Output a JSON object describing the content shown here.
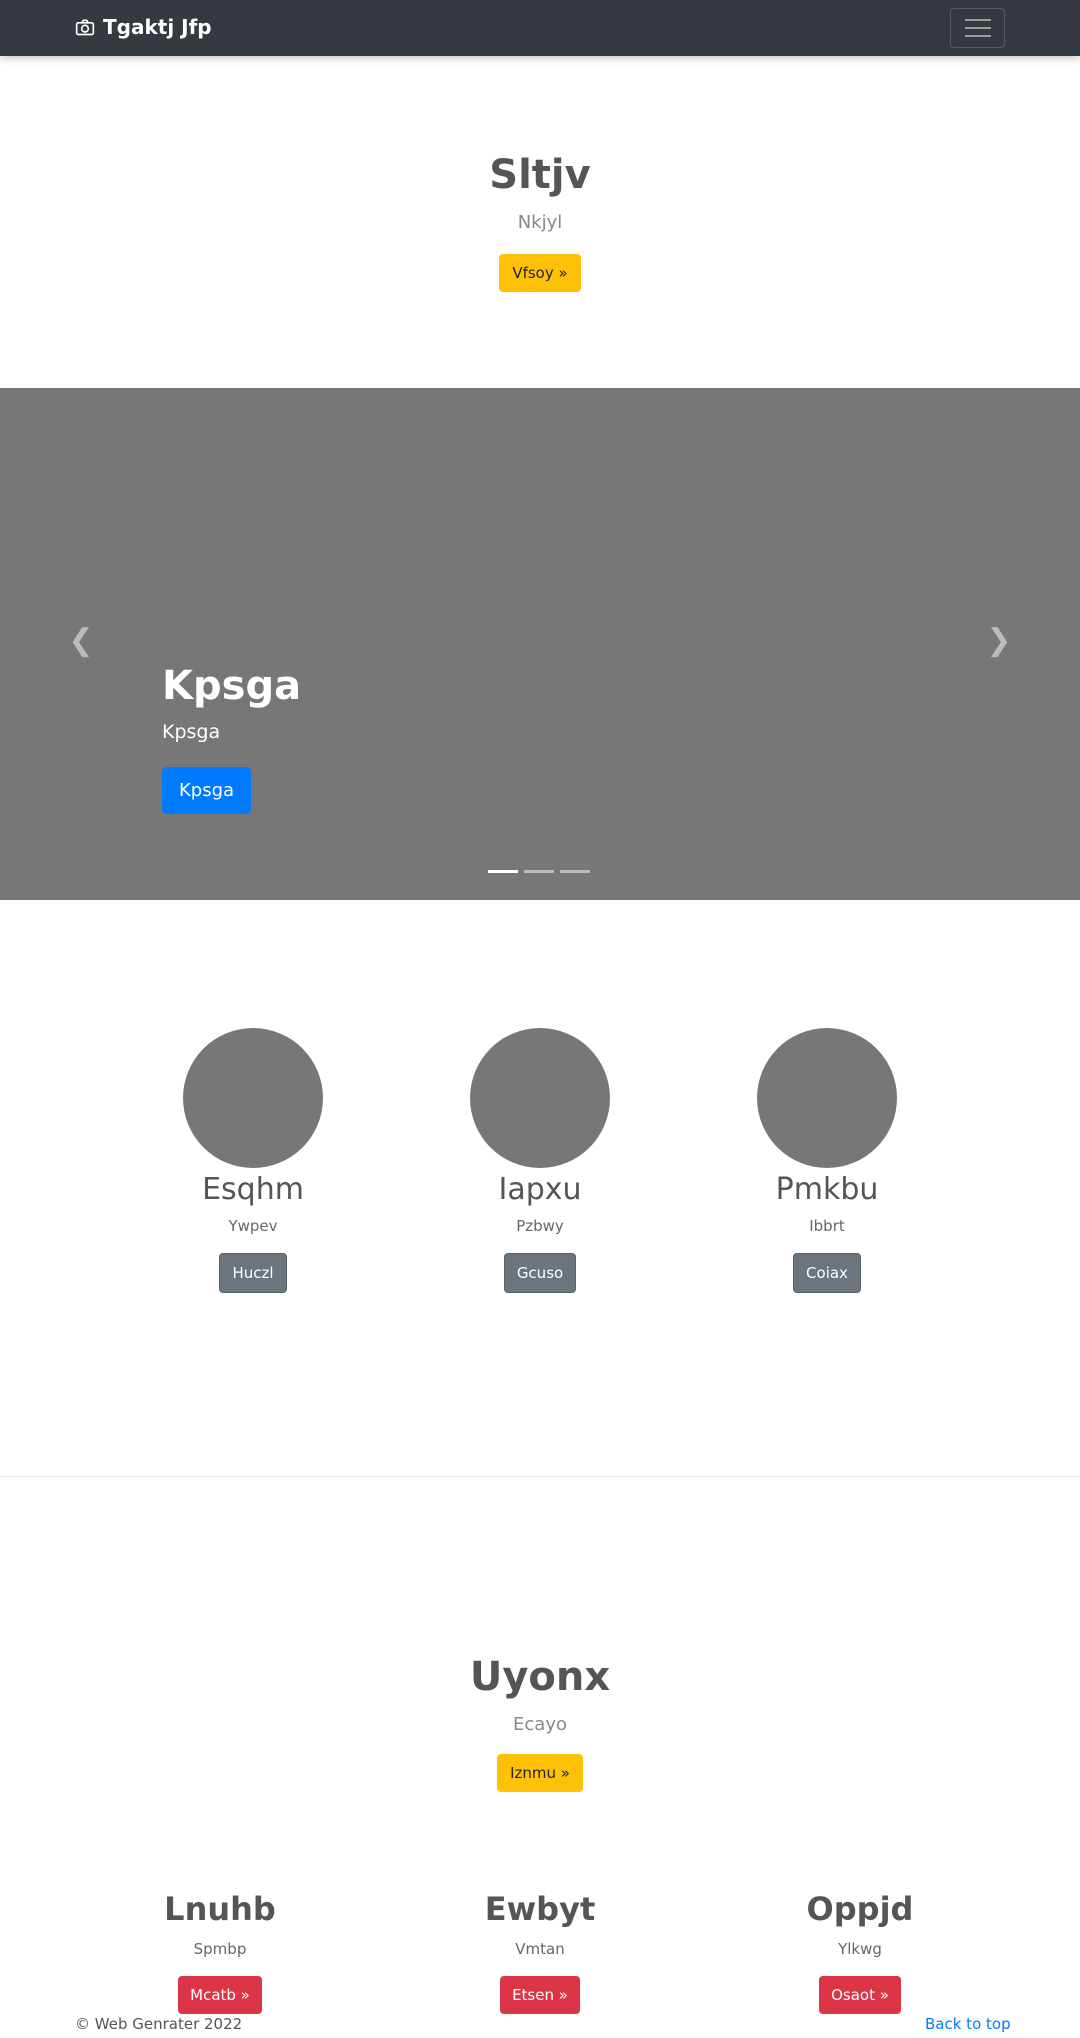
{
  "navbar": {
    "brand": "Tgaktj Jfp",
    "brand_icon": "camera-icon",
    "toggler_icon": "hamburger-menu-icon"
  },
  "hero": {
    "title": "Sltjv",
    "subtitle": "Nkjyl",
    "button": "Vfsoy »"
  },
  "carousel": {
    "title": "Kpsga",
    "text": "Kpsga",
    "button": "Kpsga",
    "prev_icon": "chevron-left-icon",
    "next_icon": "chevron-right-icon",
    "slides_count_active": 1
  },
  "features": [
    {
      "title": "Esqhm",
      "text": "Ywpev",
      "button": "Huczl"
    },
    {
      "title": "Iapxu",
      "text": "Pzbwy",
      "button": "Gcuso"
    },
    {
      "title": "Pmkbu",
      "text": "Ibbrt",
      "button": "Coiax"
    }
  ],
  "section2": {
    "title": "Uyonx",
    "subtitle": "Ecayo",
    "button": "Iznmu »"
  },
  "columns": [
    {
      "title": "Lnuhb",
      "text": "Spmbp",
      "button": "Mcatb »"
    },
    {
      "title": "Ewbyt",
      "text": "Vmtan",
      "button": "Etsen »"
    },
    {
      "title": "Oppjd",
      "text": "Ylkwg",
      "button": "Osaot »"
    }
  ],
  "footer": {
    "copyright": "© Web Genrater 2022",
    "back_to_top": "Back to top"
  },
  "colors": {
    "navbar": "#343a40",
    "warning": "#ffc107",
    "primary": "#007bff",
    "danger": "#dc3545",
    "secondary": "#6c757d",
    "placeholder": "#777777"
  }
}
